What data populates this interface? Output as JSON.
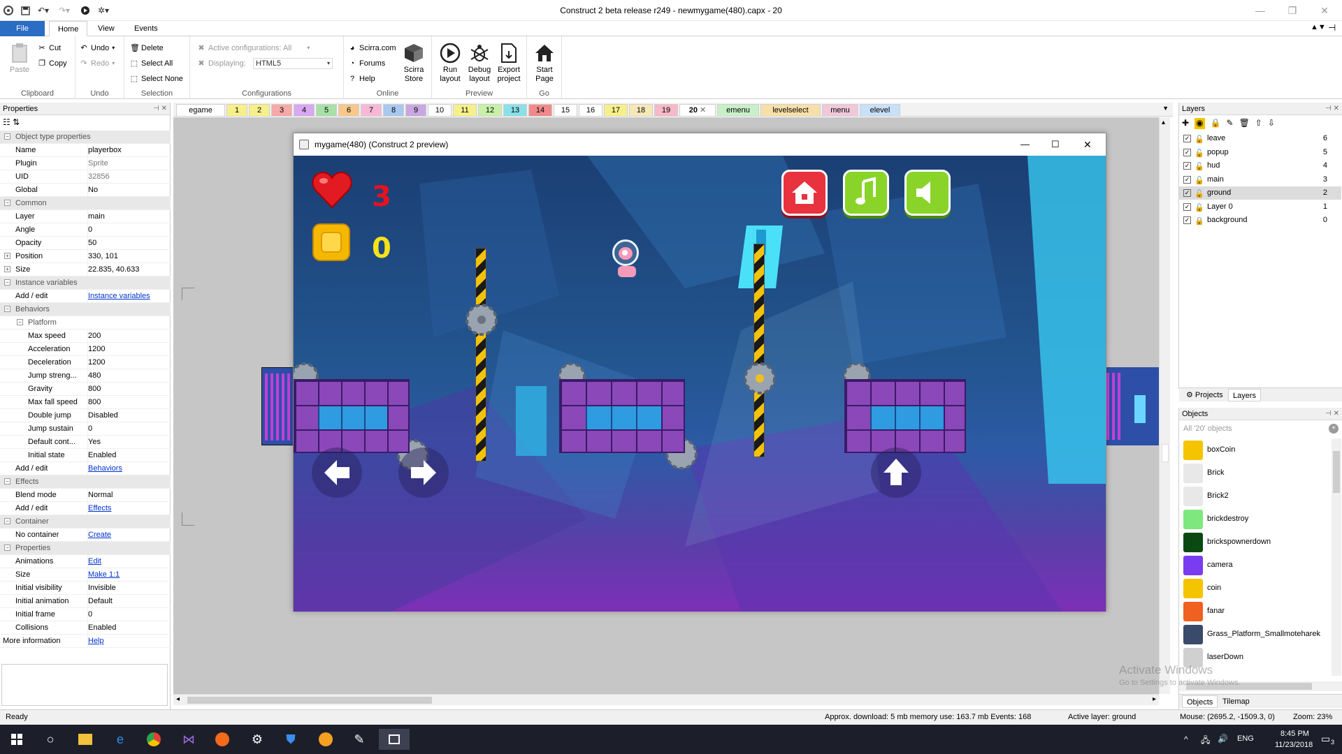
{
  "window": {
    "title": "Construct 2 beta release r249 - newmygame(480).capx - 20"
  },
  "ribbon": {
    "tabs": [
      "File",
      "Home",
      "View",
      "Events"
    ],
    "clipboard": {
      "paste": "Paste",
      "cut": "Cut",
      "copy": "Copy",
      "label": "Clipboard"
    },
    "undo": {
      "undo": "Undo",
      "redo": "Redo",
      "label": "Undo"
    },
    "selection": {
      "delete": "Delete",
      "select_all": "Select All",
      "select_none": "Select None",
      "label": "Selection"
    },
    "configurations": {
      "active": "Active configurations: All",
      "displaying_label": "Displaying:",
      "displaying_value": "HTML5",
      "label": "Configurations"
    },
    "online": {
      "scirra": "Scirra.com",
      "forums": "Forums",
      "help": "Help",
      "store_line1": "Scirra",
      "store_line2": "Store",
      "label": "Online"
    },
    "preview": {
      "run_line1": "Run",
      "run_line2": "layout",
      "debug_line1": "Debug",
      "debug_line2": "layout",
      "export_line1": "Export",
      "export_line2": "project",
      "label": "Preview"
    },
    "go": {
      "start_line1": "Start",
      "start_line2": "Page",
      "label": "Go"
    }
  },
  "properties": {
    "title": "Properties",
    "rows": [
      {
        "type": "cat",
        "key": "Object type properties"
      },
      {
        "key": "Name",
        "value": "playerbox"
      },
      {
        "key": "Plugin",
        "value": "Sprite",
        "dim": true
      },
      {
        "key": "UID",
        "value": "32856",
        "dim": true
      },
      {
        "key": "Global",
        "value": "No"
      },
      {
        "type": "cat",
        "key": "Common"
      },
      {
        "key": "Layer",
        "value": "main"
      },
      {
        "key": "Angle",
        "value": "0"
      },
      {
        "key": "Opacity",
        "value": "50"
      },
      {
        "key": "Position",
        "value": "330, 101",
        "expand": true
      },
      {
        "key": "Size",
        "value": "22.835, 40.633",
        "expand": true
      },
      {
        "type": "cat",
        "key": "Instance variables"
      },
      {
        "key": "Add / edit",
        "value": "Instance variables",
        "link": true
      },
      {
        "type": "cat",
        "key": "Behaviors"
      },
      {
        "type": "sub",
        "key": "Platform"
      },
      {
        "key": "Max speed",
        "value": "200",
        "indent": true
      },
      {
        "key": "Acceleration",
        "value": "1200",
        "indent": true
      },
      {
        "key": "Deceleration",
        "value": "1200",
        "indent": true
      },
      {
        "key": "Jump streng...",
        "value": "480",
        "indent": true
      },
      {
        "key": "Gravity",
        "value": "800",
        "indent": true
      },
      {
        "key": "Max fall speed",
        "value": "800",
        "indent": true
      },
      {
        "key": "Double jump",
        "value": "Disabled",
        "indent": true
      },
      {
        "key": "Jump sustain",
        "value": "0",
        "indent": true
      },
      {
        "key": "Default cont...",
        "value": "Yes",
        "indent": true
      },
      {
        "key": "Initial state",
        "value": "Enabled",
        "indent": true
      },
      {
        "key": "Add / edit",
        "value": "Behaviors",
        "link": true
      },
      {
        "type": "cat",
        "key": "Effects"
      },
      {
        "key": "Blend mode",
        "value": "Normal"
      },
      {
        "key": "Add / edit",
        "value": "Effects",
        "link": true
      },
      {
        "type": "cat",
        "key": "Container"
      },
      {
        "key": "No container",
        "value": "Create",
        "link": true
      },
      {
        "type": "cat",
        "key": "Properties"
      },
      {
        "key": "Animations",
        "value": "Edit",
        "link": true
      },
      {
        "key": "Size",
        "value": "Make 1:1",
        "link": true
      },
      {
        "key": "Initial visibility",
        "value": "Invisible"
      },
      {
        "key": "Initial animation",
        "value": "Default"
      },
      {
        "key": "Initial frame",
        "value": "0"
      },
      {
        "key": "Collisions",
        "value": "Enabled"
      },
      {
        "key": "More information",
        "value": "Help",
        "link": true,
        "flush": true
      }
    ]
  },
  "layout_tabs": [
    {
      "label": "egame",
      "color": "#ffffff",
      "w": 70
    },
    {
      "label": "1",
      "color": "#f7f08a",
      "w": 30
    },
    {
      "label": "2",
      "color": "#f7f08a",
      "w": 30
    },
    {
      "label": "3",
      "color": "#f7a8a8",
      "w": 30
    },
    {
      "label": "4",
      "color": "#d8a8f0",
      "w": 30
    },
    {
      "label": "5",
      "color": "#a8e0a8",
      "w": 30
    },
    {
      "label": "6",
      "color": "#f7c88a",
      "w": 30
    },
    {
      "label": "7",
      "color": "#f7b8d8",
      "w": 30
    },
    {
      "label": "8",
      "color": "#a8c8f0",
      "w": 30
    },
    {
      "label": "9",
      "color": "#c8a8e0",
      "w": 30
    },
    {
      "label": "10",
      "color": "#ffffff",
      "w": 34
    },
    {
      "label": "11",
      "color": "#f7f08a",
      "w": 34
    },
    {
      "label": "12",
      "color": "#c8f0a8",
      "w": 34
    },
    {
      "label": "13",
      "color": "#8ae0e8",
      "w": 34
    },
    {
      "label": "14",
      "color": "#f08a8a",
      "w": 34
    },
    {
      "label": "15",
      "color": "#ffffff",
      "w": 34
    },
    {
      "label": "16",
      "color": "#ffffff",
      "w": 34
    },
    {
      "label": "17",
      "color": "#f7f08a",
      "w": 34
    },
    {
      "label": "18",
      "color": "#f7e8b8",
      "w": 34
    },
    {
      "label": "19",
      "color": "#f7b8c8",
      "w": 34
    },
    {
      "label": "20",
      "color": "#e8e0f8",
      "w": 52,
      "active": true
    },
    {
      "label": "emenu",
      "color": "#c8f0c8",
      "w": 60
    },
    {
      "label": "levelselect",
      "color": "#f7e0a8",
      "w": 86
    },
    {
      "label": "menu",
      "color": "#f0c8d8",
      "w": 52
    },
    {
      "label": "elevel",
      "color": "#c8e0f8",
      "w": 58
    }
  ],
  "preview": {
    "title": "mygame(480) (Construct 2 preview)",
    "lives": "3",
    "coins": "0"
  },
  "layers": {
    "title": "Layers",
    "rows": [
      {
        "name": "leave",
        "num": "6"
      },
      {
        "name": "popup",
        "num": "5"
      },
      {
        "name": "hud",
        "num": "4"
      },
      {
        "name": "main",
        "num": "3"
      },
      {
        "name": "ground",
        "num": "2",
        "selected": true
      },
      {
        "name": "Layer 0",
        "num": "1"
      },
      {
        "name": "background",
        "num": "0",
        "locked": true
      }
    ],
    "tabs": [
      "Projects",
      "Layers"
    ]
  },
  "objects": {
    "title": "Objects",
    "filter": "All '20' objects",
    "items": [
      {
        "name": "boxCoin",
        "color": "#f5c400"
      },
      {
        "name": "Brick",
        "color": "#e8e8e8"
      },
      {
        "name": "Brick2",
        "color": "#e8e8e8"
      },
      {
        "name": "brickdestroy",
        "color": "#7ee87e"
      },
      {
        "name": "brickspownerdown",
        "color": "#0a4a12"
      },
      {
        "name": "camera",
        "color": "#7a3cf0"
      },
      {
        "name": "coin",
        "color": "#f5c400"
      },
      {
        "name": "fanar",
        "color": "#f06020"
      },
      {
        "name": "Grass_Platform_Smallmoteharek",
        "color": "#3a4a6a"
      },
      {
        "name": "laserDown",
        "color": "#d0d0d0"
      }
    ],
    "tabs": [
      "Objects",
      "Tilemap"
    ],
    "watermark_line1": "Activate Windows",
    "watermark_line2": "Go to Settings to activate Windows."
  },
  "status": {
    "ready": "Ready",
    "download": "Approx. download: 5 mb  memory use: 163.7 mb  Events: 168",
    "active_layer": "Active layer: ground",
    "mouse": "Mouse: (2695.2, -1509.3, 0)",
    "zoom": "Zoom: 23%"
  },
  "taskbar": {
    "time": "8:45 PM",
    "date": "11/23/2018",
    "lang": "ENG",
    "notif": "3"
  }
}
